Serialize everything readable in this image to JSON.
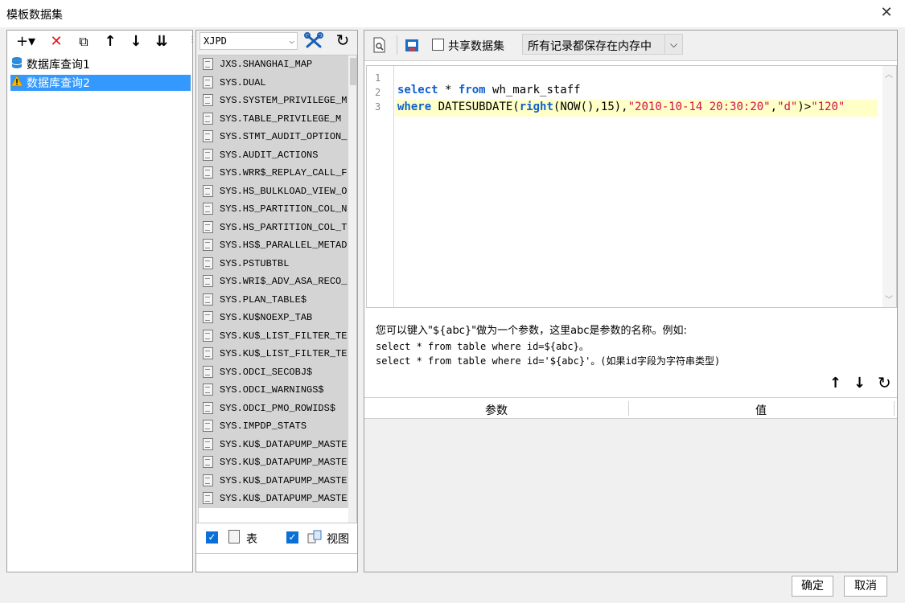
{
  "window": {
    "title": "模板数据集",
    "close_glyph": "✕"
  },
  "left_toolbar": {
    "add_glyph": "+▾",
    "delete_glyph": "✕",
    "copy_glyph": "⧉",
    "up_glyph": "↑",
    "down_glyph": "↓",
    "sort_glyph": "⇊"
  },
  "tree": {
    "items": [
      {
        "label": "数据库查询1",
        "icon": "database-icon",
        "selected": false
      },
      {
        "label": "数据库查询2",
        "icon": "warning-icon",
        "selected": true
      }
    ]
  },
  "schema": {
    "selected": "XJPD"
  },
  "tables": [
    "JXS.SHANGHAI_MAP",
    "SYS.DUAL",
    "SYS.SYSTEM_PRIVILEGE_M",
    "SYS.TABLE_PRIVILEGE_M",
    "SYS.STMT_AUDIT_OPTION_",
    "SYS.AUDIT_ACTIONS",
    "SYS.WRR$_REPLAY_CALL_F",
    "SYS.HS_BULKLOAD_VIEW_O",
    "SYS.HS_PARTITION_COL_N",
    "SYS.HS_PARTITION_COL_T",
    "SYS.HS$_PARALLEL_METAD",
    "SYS.PSTUBTBL",
    "SYS.WRI$_ADV_ASA_RECO_",
    "SYS.PLAN_TABLE$",
    "SYS.KU$NOEXP_TAB",
    "SYS.KU$_LIST_FILTER_TE",
    "SYS.KU$_LIST_FILTER_TE",
    "SYS.ODCI_SECOBJ$",
    "SYS.ODCI_WARNINGS$",
    "SYS.ODCI_PMO_ROWIDS$",
    "SYS.IMPDP_STATS",
    "SYS.KU$_DATAPUMP_MASTE",
    "SYS.KU$_DATAPUMP_MASTE",
    "SYS.KU$_DATAPUMP_MASTE",
    "SYS.KU$_DATAPUMP_MASTE"
  ],
  "filters": {
    "table_label": "表",
    "table_checked": true,
    "view_label": "视图",
    "view_checked": true
  },
  "right_toolbar": {
    "share_label": "共享数据集",
    "share_checked": false,
    "memory_option": "所有记录都保存在内存中"
  },
  "editor": {
    "line_numbers": [
      "1",
      "2",
      "3"
    ],
    "line2": {
      "kw1": "select",
      "op": " * ",
      "kw2": "from",
      "rest": " wh_mark_staff"
    },
    "line3": {
      "kw": "where",
      "p1": " DATESUBDATE(",
      "fn": "right",
      "p2": "(NOW(),15),",
      "s1": "\"2010-10-14 20:30:20\"",
      "c1": ",",
      "s2": "\"d\"",
      "c2": ")>",
      "s3": "\"120\""
    }
  },
  "hint": {
    "line1": "您可以键入\"${abc}\"做为一个参数，这里abc是参数的名称。例如:",
    "line2": "select * from table where id=${abc}。",
    "line3": "select * from table where id='${abc}'。(如果id字段为字符串类型)"
  },
  "params": {
    "col_param": "参数",
    "col_value": "值",
    "up_glyph": "↑",
    "down_glyph": "↓",
    "refresh_glyph": "↻"
  },
  "footer": {
    "ok_label": "确定",
    "cancel_label": "取消"
  },
  "colors": {
    "selected_bg": "#3399ff",
    "highlight_line": "#ffffc8",
    "table_row_bg": "#d4d4d4"
  }
}
